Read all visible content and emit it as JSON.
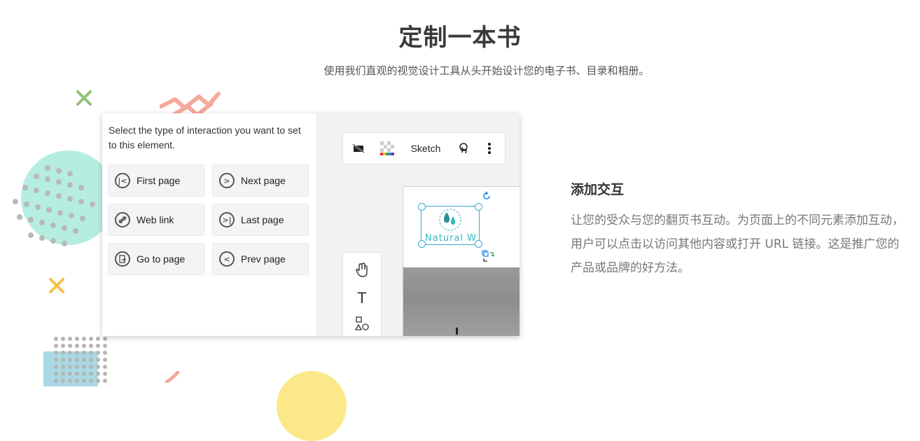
{
  "header": {
    "title": "定制一本书",
    "subtitle": "使用我们直观的视觉设计工具从头开始设计您的电子书、目录和相册。"
  },
  "interaction_panel": {
    "prompt": "Select the type of interaction you want to set to this element.",
    "options": [
      {
        "label": "First page",
        "icon": "first-page-icon"
      },
      {
        "label": "Next page",
        "icon": "next-page-icon"
      },
      {
        "label": "Web link",
        "icon": "link-icon"
      },
      {
        "label": "Last page",
        "icon": "last-page-icon"
      },
      {
        "label": "Go to page",
        "icon": "goto-page-icon"
      },
      {
        "label": "Prev page",
        "icon": "prev-page-icon"
      }
    ]
  },
  "editor_toolbar": {
    "sketch_label": "Sketch",
    "icons": [
      "image-off-icon",
      "transparency-icon",
      "touch-icon",
      "more-vertical-icon"
    ]
  },
  "side_tools": [
    "hand-tool-icon",
    "text-tool-icon",
    "shapes-tool-icon"
  ],
  "canvas": {
    "logo_text": "Natural W"
  },
  "feature": {
    "title": "添加交互",
    "body": "让您的受众与您的翻页书互动。为页面上的不同元素添加互动，用户可以点击以访问其他内容或打开 URL 链接。这是推广您的产品或品牌的好方法。"
  },
  "colors": {
    "mint": "#b5ede1",
    "coral": "#f5a99c",
    "green_cross": "#8fc27a",
    "yellow_cross": "#f7c244",
    "accent_teal": "#37b8c0"
  }
}
